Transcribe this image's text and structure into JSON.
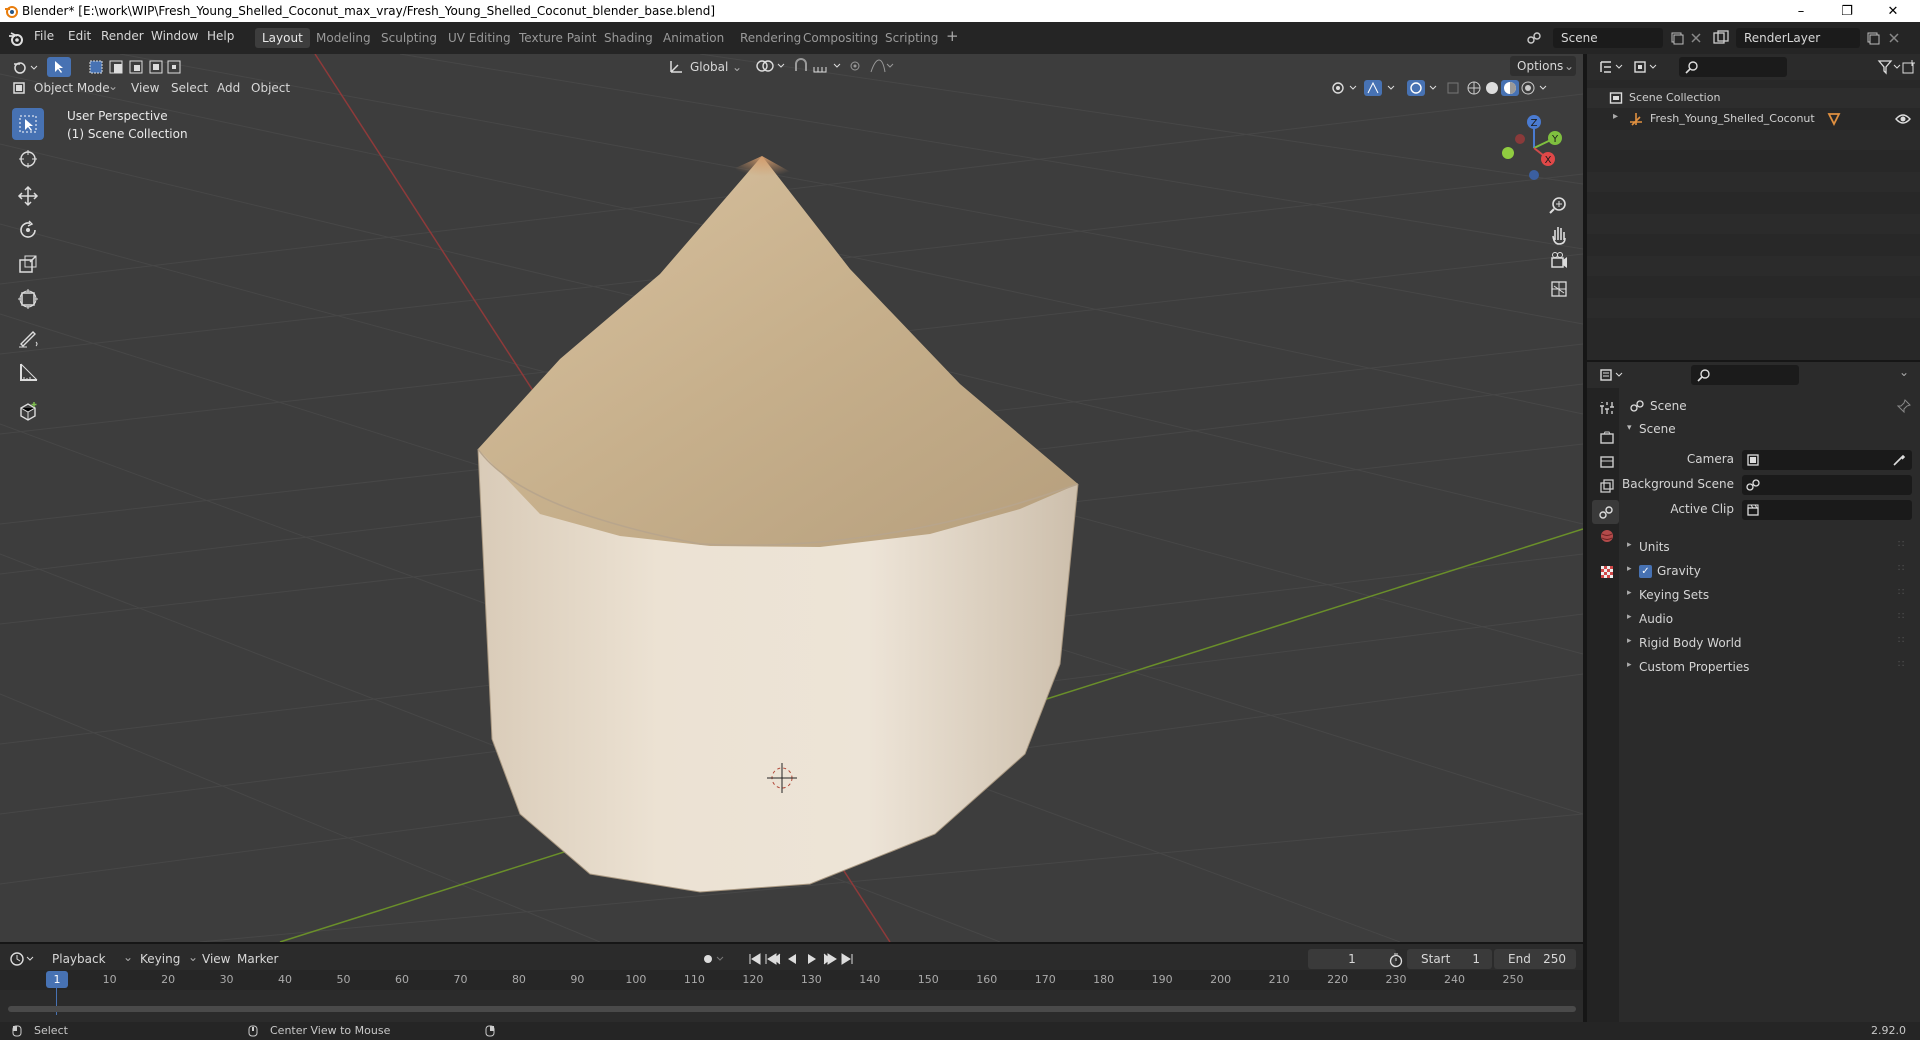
{
  "window": {
    "title": "Blender* [E:\\work\\WIP\\Fresh_Young_Shelled_Coconut_max_vray/Fresh_Young_Shelled_Coconut_blender_base.blend]",
    "controls": [
      "minimize",
      "restore",
      "close"
    ]
  },
  "menubar": {
    "menus": [
      "File",
      "Edit",
      "Render",
      "Window",
      "Help"
    ],
    "workspaces": [
      "Layout",
      "Modeling",
      "Sculpting",
      "UV Editing",
      "Texture Paint",
      "Shading",
      "Animation",
      "Rendering",
      "Compositing",
      "Scripting"
    ],
    "active_workspace": "Layout",
    "add_workspace": "+",
    "scene_name": "Scene",
    "view_layer": "RenderLayer"
  },
  "viewport": {
    "mode": "Object Mode",
    "menus": [
      "View",
      "Select",
      "Add",
      "Object"
    ],
    "transform_orientation": "Global",
    "options_label": "Options",
    "overlay_line1": "User Perspective",
    "overlay_line2": "(1) Scene Collection",
    "gizmo_axes": [
      "Z",
      "Y",
      "X"
    ],
    "tools": [
      "select-box",
      "cursor",
      "move",
      "rotate",
      "scale",
      "transform",
      "annotate",
      "measure",
      "add-cube"
    ],
    "shading_mode": "solid",
    "colors": {
      "background": "#3d3d3d",
      "grid": "#4a4a4a",
      "x_axis": "#9b3a3a",
      "y_axis": "#6a9a2a",
      "accent": "#4772b3"
    }
  },
  "outliner": {
    "root": "Scene Collection",
    "items": [
      {
        "name": "Fresh_Young_Shelled_Coconut",
        "type": "empty"
      }
    ]
  },
  "properties": {
    "context": "Scene",
    "panel": "Scene",
    "fields": [
      {
        "label": "Camera",
        "value": ""
      },
      {
        "label": "Background Scene",
        "value": ""
      },
      {
        "label": "Active Clip",
        "value": ""
      }
    ],
    "subpanels": [
      "Units",
      "Gravity",
      "Keying Sets",
      "Audio",
      "Rigid Body World",
      "Custom Properties"
    ],
    "gravity_checked": true
  },
  "timeline": {
    "menus": [
      "Playback",
      "Keying",
      "View",
      "Marker"
    ],
    "current_frame": "1",
    "start_label": "Start",
    "start": "1",
    "end_label": "End",
    "end": "250",
    "ticks": [
      "1",
      "10",
      "20",
      "30",
      "40",
      "50",
      "60",
      "70",
      "80",
      "90",
      "100",
      "110",
      "120",
      "130",
      "140",
      "150",
      "160",
      "170",
      "180",
      "190",
      "200",
      "210",
      "220",
      "230",
      "240",
      "250"
    ]
  },
  "statusbar": {
    "select": "Select",
    "center_view": "Center View to Mouse",
    "version": "2.92.0"
  }
}
